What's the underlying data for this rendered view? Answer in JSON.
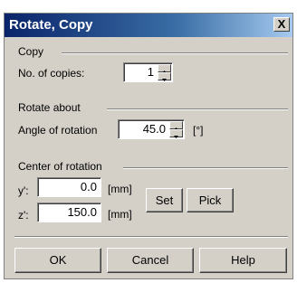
{
  "window": {
    "title": "Rotate, Copy",
    "close_label": "X"
  },
  "copy": {
    "group_label": "Copy",
    "copies_label": "No. of copies:",
    "copies_value": "1"
  },
  "rotate": {
    "group_label": "Rotate about",
    "angle_label": "Angle of rotation",
    "angle_value": "45.0",
    "angle_unit": "[°]"
  },
  "center": {
    "group_label": "Center of rotation",
    "y_label": "y':",
    "y_value": "0.0",
    "y_unit": "[mm]",
    "z_label": "z':",
    "z_value": "150.0",
    "z_unit": "[mm]",
    "set_label": "Set",
    "pick_label": "Pick"
  },
  "buttons": {
    "ok": "OK",
    "cancel": "Cancel",
    "help": "Help"
  }
}
